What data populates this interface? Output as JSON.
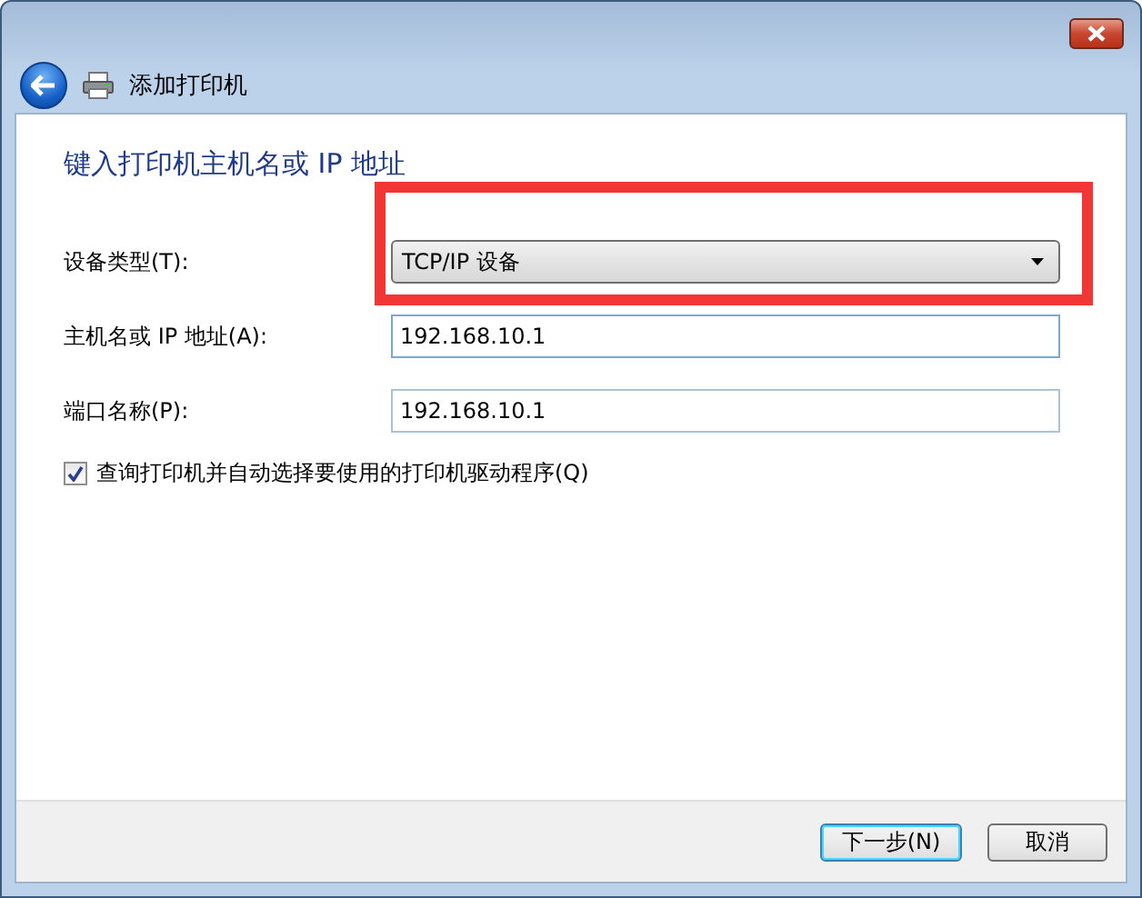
{
  "window": {
    "title": "添加打印机"
  },
  "heading": "键入打印机主机名或 IP 地址",
  "fields": [
    {
      "kind": "dropdown",
      "label": "设备类型(T):",
      "value": "TCP/IP 设备",
      "highlighted": true
    },
    {
      "kind": "text",
      "label": "主机名或 IP 地址(A):",
      "value": "192.168.10.1",
      "focused": true,
      "highlighted": false
    },
    {
      "kind": "text",
      "label": "端口名称(P):",
      "value": "192.168.10.1",
      "focused": false,
      "highlighted": false
    }
  ],
  "checkbox": {
    "label": "查询打印机并自动选择要使用的打印机驱动程序(Q)",
    "checked": true
  },
  "buttons": [
    {
      "label": "下一步(N)",
      "default": true
    },
    {
      "label": "取消",
      "default": false
    }
  ]
}
